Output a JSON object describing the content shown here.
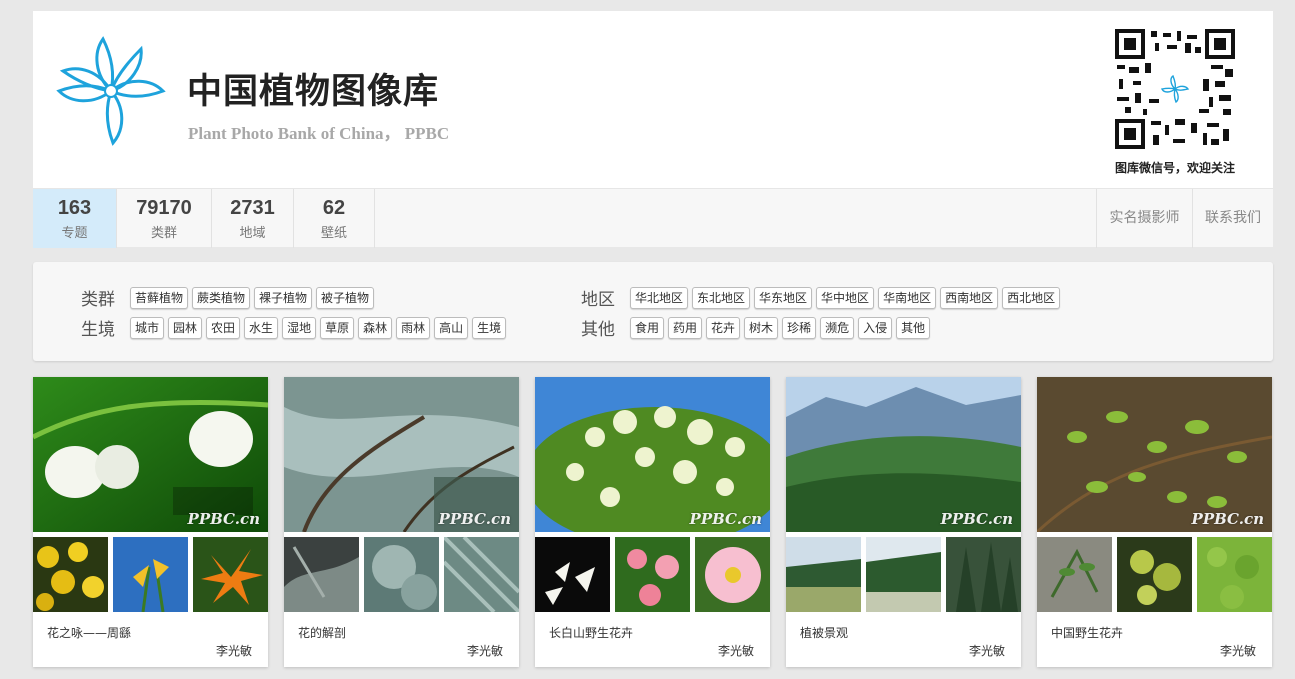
{
  "header": {
    "title": "中国植物图像库",
    "subtitle": "Plant Photo Bank of China， PPBC",
    "qr_caption": "图库微信号，欢迎关注",
    "brand_color": "#1ea3dc"
  },
  "stats": [
    {
      "value": "163",
      "label": "专题"
    },
    {
      "value": "79170",
      "label": "类群"
    },
    {
      "value": "2731",
      "label": "地域"
    },
    {
      "value": "62",
      "label": "壁纸"
    }
  ],
  "top_links": [
    "实名摄影师",
    "联系我们"
  ],
  "filters": {
    "taxa": {
      "label": "类群",
      "tags": [
        "苔藓植物",
        "蕨类植物",
        "裸子植物",
        "被子植物"
      ]
    },
    "habitat": {
      "label": "生境",
      "tags": [
        "城市",
        "园林",
        "农田",
        "水生",
        "湿地",
        "草原",
        "森林",
        "雨林",
        "高山",
        "生境"
      ]
    },
    "region": {
      "label": "地区",
      "tags": [
        "华北地区",
        "东北地区",
        "华东地区",
        "华中地区",
        "华南地区",
        "西南地区",
        "西北地区"
      ]
    },
    "other": {
      "label": "其他",
      "tags": [
        "食用",
        "药用",
        "花卉",
        "树木",
        "珍稀",
        "濒危",
        "入侵",
        "其他"
      ]
    }
  },
  "watermark": "PPBC.cn",
  "cards": [
    {
      "title": "花之咏——周繇",
      "author": "李光敏"
    },
    {
      "title": "花的解剖",
      "author": "李光敏"
    },
    {
      "title": "长白山野生花卉",
      "author": "李光敏"
    },
    {
      "title": "植被景观",
      "author": "李光敏"
    },
    {
      "title": "中国野生花卉",
      "author": "李光敏"
    }
  ]
}
